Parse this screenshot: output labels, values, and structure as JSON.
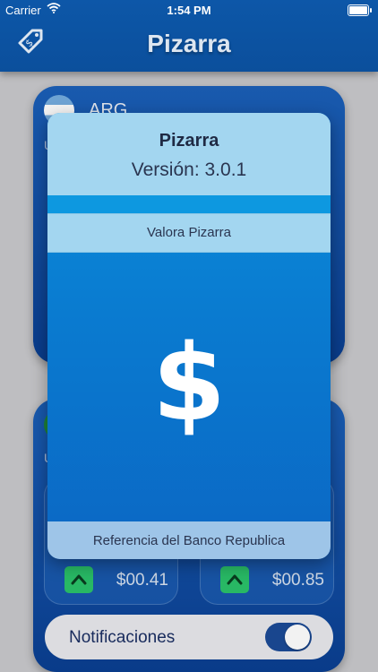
{
  "status_bar": {
    "carrier": "Carrier",
    "time": "1:54 PM"
  },
  "nav": {
    "title": "Pizarra",
    "left_icon": "price-tag-icon"
  },
  "cards": [
    {
      "currency": "ARG",
      "flag": "argentina-flag",
      "sub": "U"
    },
    {
      "currency": "",
      "flag": "brazil-flag",
      "sub": "U",
      "quotes": [
        {
          "direction": "up",
          "value": "$00.41"
        },
        {
          "direction": "up",
          "value": "$00.85"
        }
      ]
    }
  ],
  "notifications": {
    "label": "Notificaciones",
    "enabled": true
  },
  "dialog": {
    "title": "Pizarra",
    "version": "Versión: 3.0.1",
    "rate_label": "Valora Pizarra",
    "icon_glyph": "$",
    "reference": "Referencia del Banco Republica"
  },
  "colors": {
    "nav_blue": "#0d57a8",
    "dialog_light": "#a3d6f0",
    "up_green": "#2bc26a",
    "toggle_on": "#1b4a96"
  }
}
